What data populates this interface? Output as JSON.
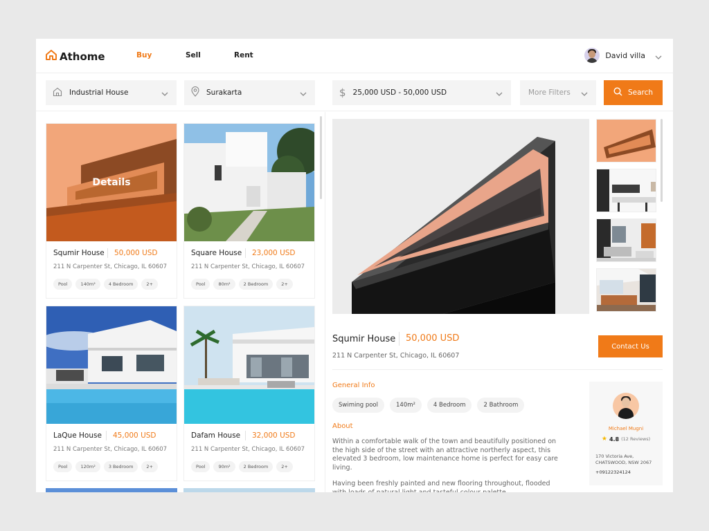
{
  "app": {
    "logo": "Athome"
  },
  "nav": [
    {
      "label": "Buy",
      "active": true
    },
    {
      "label": "Sell",
      "active": false
    },
    {
      "label": "Rent",
      "active": false
    }
  ],
  "user": {
    "name": "David villa"
  },
  "filters": {
    "type": "Industrial House",
    "location": "Surakarta",
    "price_range": "25,000 USD - 50,000 USD",
    "more": "More Filters",
    "search_label": "Search"
  },
  "listings": [
    {
      "title": "Squmir House",
      "price": "50,000 USD",
      "address": "211 N Carpenter St, Chicago, IL 60607",
      "tags": [
        "Pool",
        "140m²",
        "4 Bedroom",
        "2+"
      ],
      "overlay": "Details"
    },
    {
      "title": "Square House",
      "price": "23,000 USD",
      "address": "211 N Carpenter St, Chicago, IL 60607",
      "tags": [
        "Pool",
        "80m²",
        "2 Bedroom",
        "2+"
      ]
    },
    {
      "title": "LaQue House",
      "price": "45,000 USD",
      "address": "211 N Carpenter St, Chicago, IL 60607",
      "tags": [
        "Pool",
        "120m²",
        "3 Bedroom",
        "2+"
      ]
    },
    {
      "title": "Dafam House",
      "price": "32,000 USD",
      "address": "211 N Carpenter St, Chicago, IL 60607",
      "tags": [
        "Pool",
        "90m²",
        "2 Bedroom",
        "2+"
      ]
    }
  ],
  "detail": {
    "title": "Squmir House",
    "price": "50,000 USD",
    "address": "211 N Carpenter St, Chicago, IL 60607",
    "contact_label": "Contact Us",
    "general_info_title": "General Info",
    "general_info": [
      "Swiming pool",
      "140m²",
      "4 Bedroom",
      "2 Bathroom"
    ],
    "about_title": "About",
    "about_p1": "Within a comfortable walk of the town and beautifully positioned on the high side of the street with an attractive northerly aspect, this elevated 3 bedroom, low maintenance home is perfect for easy care living.",
    "about_p2": "Having been freshly painted and new flooring throughout, flooded with loads of natural light and tasteful colour palette"
  },
  "agent": {
    "name": "Michael Mugni",
    "rating": "4.8",
    "reviews": "(12 Reviews)",
    "address_line1": "170 Victoria Ave,",
    "address_line2": "CHATSWOOD, NSW 2067",
    "phone": "+09122324124"
  },
  "colors": {
    "accent": "#f07a18",
    "background": "#e9e9e9",
    "panel": "#f4f4f4"
  }
}
